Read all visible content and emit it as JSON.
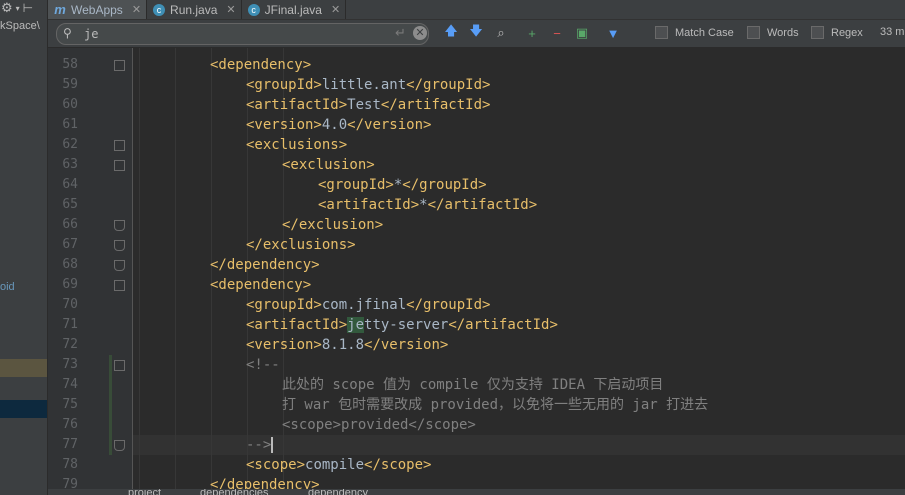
{
  "tabs": [
    {
      "label": "WebApps",
      "icon": "maven-icon",
      "color": "#6fa8dc",
      "active": true
    },
    {
      "label": "Run.java",
      "icon": "java-class-icon",
      "color": "#3f8fb5",
      "active": false
    },
    {
      "label": "JFinal.java",
      "icon": "java-class-icon",
      "color": "#3f8fb5",
      "active": false
    }
  ],
  "sidebar": {
    "path_text": "kSpace\\",
    "void_text": "oid"
  },
  "search": {
    "value": "je",
    "options": [
      {
        "label": "Match Case",
        "checked": false
      },
      {
        "label": "Words",
        "checked": false
      },
      {
        "label": "Regex",
        "checked": false
      }
    ],
    "match_count": "33 m"
  },
  "editor": {
    "lines": [
      {
        "n": "58",
        "indent": 2,
        "parts": [
          [
            "tg",
            "<dependency>"
          ]
        ]
      },
      {
        "n": "59",
        "indent": 3,
        "parts": [
          [
            "tg",
            "<groupId>"
          ],
          [
            "tx",
            "little.ant"
          ],
          [
            "tg",
            "</groupId>"
          ]
        ]
      },
      {
        "n": "60",
        "indent": 3,
        "parts": [
          [
            "tg",
            "<artifactId>"
          ],
          [
            "tx",
            "Test"
          ],
          [
            "tg",
            "</artifactId>"
          ]
        ]
      },
      {
        "n": "61",
        "indent": 3,
        "parts": [
          [
            "tg",
            "<version>"
          ],
          [
            "tx",
            "4.0"
          ],
          [
            "tg",
            "</version>"
          ]
        ]
      },
      {
        "n": "62",
        "indent": 3,
        "parts": [
          [
            "tg",
            "<exclusions>"
          ]
        ]
      },
      {
        "n": "63",
        "indent": 4,
        "parts": [
          [
            "tg",
            "<exclusion>"
          ]
        ]
      },
      {
        "n": "64",
        "indent": 5,
        "parts": [
          [
            "tg",
            "<groupId>"
          ],
          [
            "tx",
            "*"
          ],
          [
            "tg",
            "</groupId>"
          ]
        ]
      },
      {
        "n": "65",
        "indent": 5,
        "parts": [
          [
            "tg",
            "<artifactId>"
          ],
          [
            "tx",
            "*"
          ],
          [
            "tg",
            "</artifactId>"
          ]
        ]
      },
      {
        "n": "66",
        "indent": 4,
        "parts": [
          [
            "tg",
            "</exclusion>"
          ]
        ]
      },
      {
        "n": "67",
        "indent": 3,
        "parts": [
          [
            "tg",
            "</exclusions>"
          ]
        ]
      },
      {
        "n": "68",
        "indent": 2,
        "parts": [
          [
            "tg",
            "</dependency>"
          ]
        ]
      },
      {
        "n": "69",
        "indent": 2,
        "parts": [
          [
            "tg",
            "<dependency>"
          ]
        ]
      },
      {
        "n": "70",
        "indent": 3,
        "parts": [
          [
            "tg",
            "<groupId>"
          ],
          [
            "tx",
            "com.jfinal"
          ],
          [
            "tg",
            "</groupId>"
          ]
        ]
      },
      {
        "n": "71",
        "indent": 3,
        "parts": [
          [
            "tg",
            "<artifactId>"
          ],
          [
            "hlm",
            "je"
          ],
          [
            "tx",
            "tty-server"
          ],
          [
            "tg",
            "</artifactId>"
          ]
        ]
      },
      {
        "n": "72",
        "indent": 3,
        "parts": [
          [
            "tg",
            "<version>"
          ],
          [
            "tx",
            "8.1.8"
          ],
          [
            "tg",
            "</version>"
          ]
        ]
      },
      {
        "n": "73",
        "indent": 3,
        "parts": [
          [
            "cm",
            "<!--"
          ]
        ]
      },
      {
        "n": "74",
        "indent": 4,
        "parts": [
          [
            "cm",
            "此处的 scope 值为 compile 仅为支持 IDEA 下启动项目"
          ]
        ]
      },
      {
        "n": "75",
        "indent": 4,
        "parts": [
          [
            "cm",
            "打 war 包时需要改成 provided，以免将一些无用的 jar 打进去"
          ]
        ]
      },
      {
        "n": "76",
        "indent": 4,
        "parts": [
          [
            "cm",
            "<scope>provided</scope>"
          ]
        ]
      },
      {
        "n": "77",
        "indent": 3,
        "parts": [
          [
            "cm",
            "-->"
          ],
          [
            "cursor",
            ""
          ]
        ]
      },
      {
        "n": "78",
        "indent": 3,
        "parts": [
          [
            "tg",
            "<scope>"
          ],
          [
            "tx",
            "compile"
          ],
          [
            "tg",
            "</scope>"
          ]
        ]
      },
      {
        "n": "79",
        "indent": 2,
        "parts": [
          [
            "tg",
            "</dependency>"
          ]
        ]
      }
    ]
  },
  "breadcrumb": [
    "project",
    "dependencies",
    "dependency"
  ],
  "colors": {
    "tag": "#e8bf6a",
    "text": "#a9b7c6",
    "comment": "#808080",
    "match_highlight": "#32593d",
    "background": "#2b2b2b"
  }
}
